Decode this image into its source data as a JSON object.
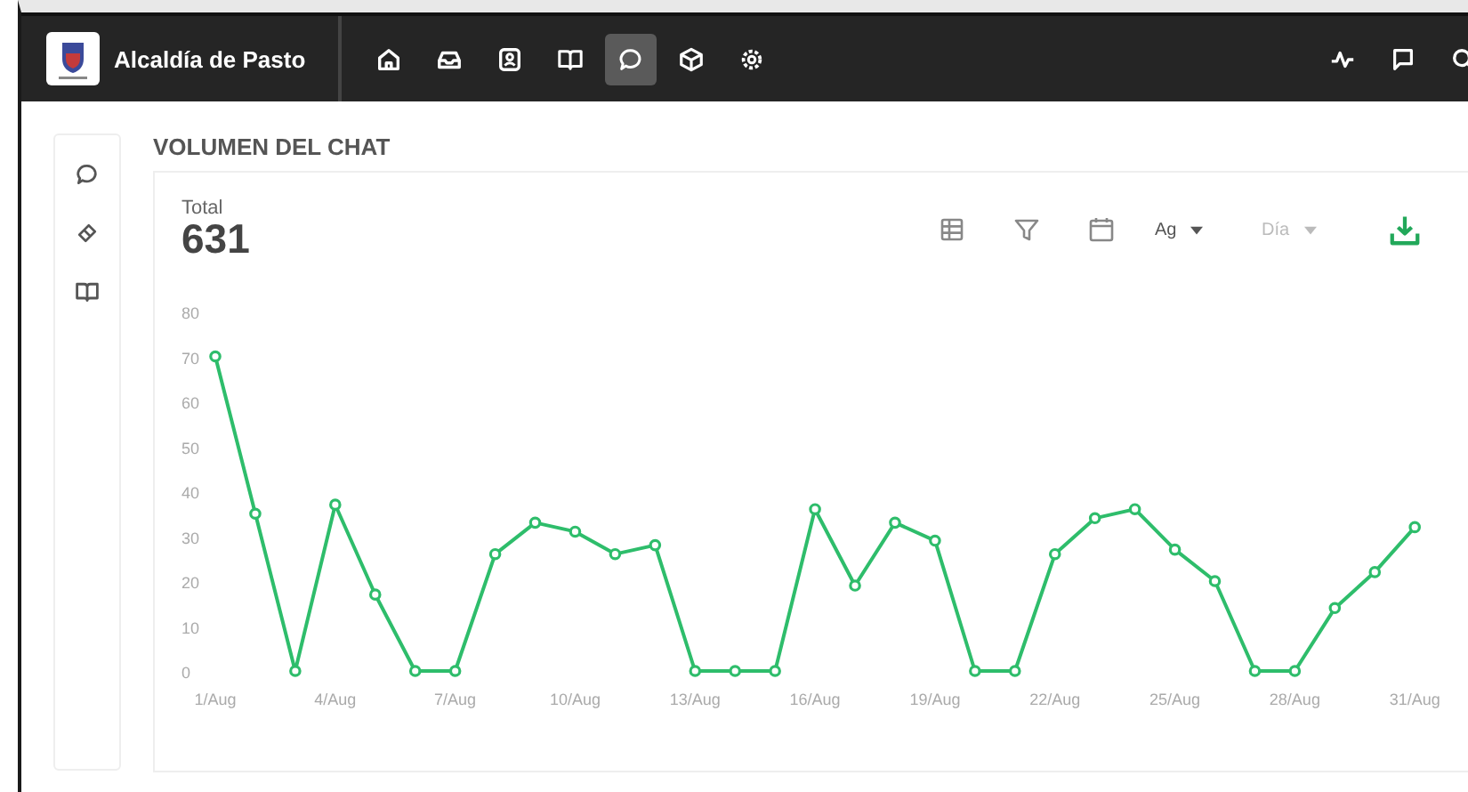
{
  "topbar": {
    "title": "Alcaldía de Pasto",
    "nav": [
      {
        "kind": "home",
        "selected": false
      },
      {
        "kind": "inbox",
        "selected": false
      },
      {
        "kind": "contact",
        "selected": false
      },
      {
        "kind": "book",
        "selected": false
      },
      {
        "kind": "chat",
        "selected": true
      },
      {
        "kind": "box",
        "selected": false
      },
      {
        "kind": "gear",
        "selected": false
      }
    ],
    "actions": [
      {
        "kind": "pulse"
      },
      {
        "kind": "message"
      },
      {
        "kind": "search"
      }
    ]
  },
  "sidebar": {
    "items": [
      {
        "kind": "chat"
      },
      {
        "kind": "ticket"
      },
      {
        "kind": "book"
      }
    ]
  },
  "section_title": "VOLUMEN DEL CHAT",
  "card": {
    "total_label": "Total",
    "total_value": "631",
    "toolbar": [
      {
        "kind": "table"
      },
      {
        "kind": "filter"
      },
      {
        "kind": "calendar"
      },
      {
        "kind": "dropdown",
        "value": "Ag",
        "disabled": false
      },
      {
        "kind": "dropdown",
        "value": "Día",
        "disabled": true
      },
      {
        "kind": "download"
      }
    ],
    "chart_data": {
      "type": "line",
      "categories": [
        "1/Aug",
        null,
        null,
        "4/Aug",
        null,
        null,
        "7/Aug",
        null,
        null,
        "10/Aug",
        null,
        null,
        "13/Aug",
        null,
        null,
        "16/Aug",
        null,
        null,
        "19/Aug",
        null,
        null,
        "22/Aug",
        null,
        null,
        "25/Aug",
        null,
        null,
        "28/Aug",
        null,
        null,
        "31/Aug"
      ],
      "series": [
        {
          "color": "#2ebd6b",
          "marker": "circle",
          "values": [
            70,
            35,
            0,
            37,
            17,
            0,
            0,
            26,
            33,
            31,
            26,
            28,
            0,
            0,
            0,
            36,
            19,
            33,
            29,
            0,
            0,
            26,
            34,
            36,
            27,
            20,
            0,
            0,
            14,
            22,
            32
          ]
        }
      ],
      "ylim": [
        0,
        80
      ],
      "yticks": [
        0,
        10,
        20,
        30,
        40,
        50,
        60,
        70,
        80
      ]
    }
  }
}
